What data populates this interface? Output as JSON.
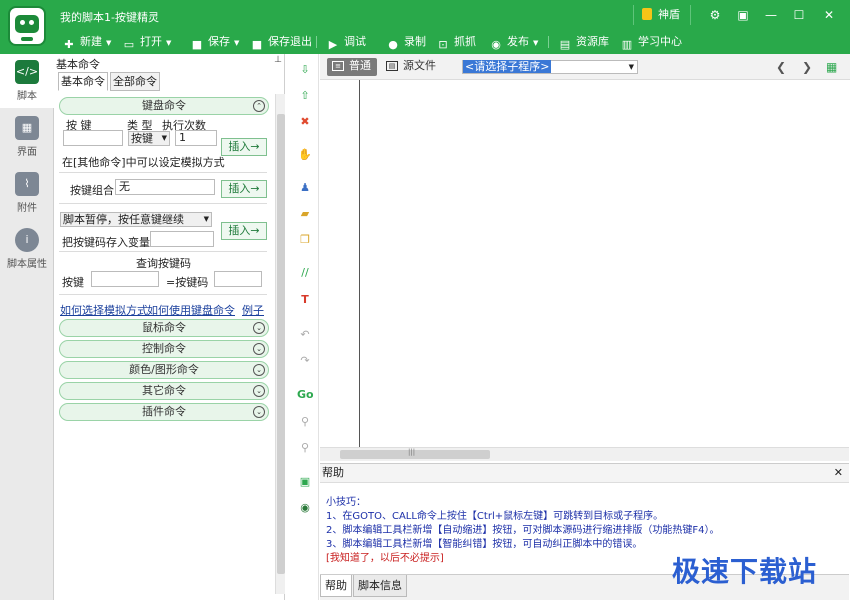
{
  "window": {
    "title": "我的脚本1-按键精灵",
    "badge": "神盾"
  },
  "toolbar": [
    {
      "label": "新建",
      "icon": "plus-icon",
      "dropdown": true
    },
    {
      "label": "打开",
      "icon": "folder-icon",
      "dropdown": true
    },
    {
      "label": "保存",
      "icon": "save-icon",
      "dropdown": true
    },
    {
      "label": "保存退出",
      "icon": "save-exit-icon",
      "dropdown": false
    },
    {
      "label": "调试",
      "icon": "debug-play-icon",
      "dropdown": false
    },
    {
      "label": "录制",
      "icon": "record-icon",
      "dropdown": false
    },
    {
      "label": "抓抓",
      "icon": "capture-icon",
      "dropdown": false
    },
    {
      "label": "发布",
      "icon": "publish-icon",
      "dropdown": true
    },
    {
      "label": "资源库",
      "icon": "library-icon",
      "dropdown": false
    },
    {
      "label": "学习中心",
      "icon": "learn-icon",
      "dropdown": false
    }
  ],
  "sidebar": {
    "items": [
      {
        "label": "脚本",
        "icon": "script-icon",
        "active": true
      },
      {
        "label": "界面",
        "icon": "ui-icon",
        "active": false
      },
      {
        "label": "附件",
        "icon": "attachment-icon",
        "active": false
      },
      {
        "label": "脚本属性",
        "icon": "info-icon",
        "active": false
      }
    ]
  },
  "commands": {
    "panel_title": "基本命令",
    "tabs": [
      "基本命令",
      "全部命令"
    ],
    "keyboard": {
      "header": "键盘命令",
      "col_key": "按 键",
      "col_type": "类 型",
      "col_count": "执行次数",
      "type_value": "按键",
      "count_value": "1",
      "insert": "插入→",
      "hint": "在[其他命令]中可以设定模拟方式",
      "combo_label": "按键组合",
      "combo_value": "无",
      "pause_select": "脚本暂停，按任意键继续",
      "store_label": "把按键码存入变量",
      "query_title": "查询按键码",
      "query_key": "按键",
      "query_code": "=按键码"
    },
    "links": [
      "如何选择模拟方式",
      "如何使用键盘命令",
      "例子"
    ],
    "sections": [
      "鼠标命令",
      "控制命令",
      "颜色/图形命令",
      "其它命令",
      "插件命令"
    ]
  },
  "editor": {
    "tabs": [
      "普通",
      "源文件"
    ],
    "procedure": "<请选择子程序>"
  },
  "help": {
    "title": "帮助",
    "tip_title": "小技巧：",
    "lines": [
      "1、在GOTO、CALL命令上按住【Ctrl+鼠标左键】可跳转到目标或子程序。",
      "2、脚本编辑工具栏新增【自动缩进】按钮，可对脚本源码进行缩进排版（功能热键F4）。",
      "3、脚本编辑工具栏新增【智能纠错】按钮，可自动纠正脚本中的错误。"
    ],
    "dismiss": "[我知道了，以后不必提示]"
  },
  "bottom_tabs": [
    "帮助",
    "脚本信息"
  ],
  "watermark": "极速下载站",
  "colors": {
    "brand_green": "#29a94a",
    "link_blue": "#1a3f9c",
    "help_blue": "#1c2fa8",
    "dismiss_red": "#c81e1e"
  }
}
